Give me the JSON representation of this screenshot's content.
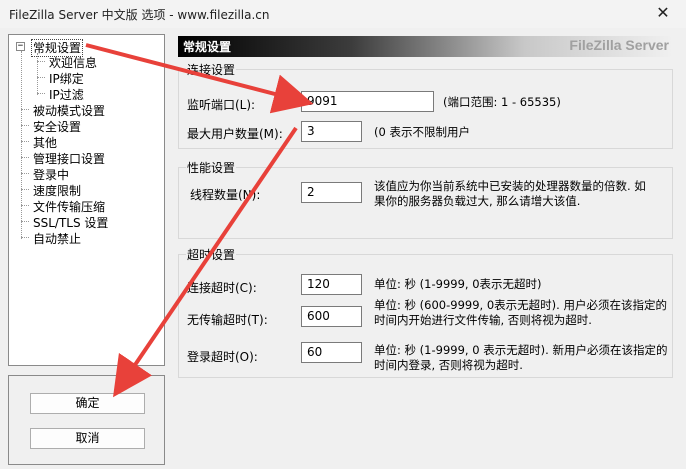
{
  "window": {
    "title": "FileZilla Server 中文版 选项 - www.filezilla.cn",
    "close_glyph": "✕"
  },
  "tree": {
    "items": [
      {
        "label": "常规设置",
        "expanded": true
      },
      {
        "label": "欢迎信息"
      },
      {
        "label": "IP绑定"
      },
      {
        "label": "IP过滤"
      },
      {
        "label": "被动模式设置"
      },
      {
        "label": "安全设置"
      },
      {
        "label": "其他"
      },
      {
        "label": "管理接口设置"
      },
      {
        "label": "登录中"
      },
      {
        "label": "速度限制"
      },
      {
        "label": "文件传输压缩"
      },
      {
        "label": "SSL/TLS 设置"
      },
      {
        "label": "自动禁止"
      }
    ],
    "expander_glyph": "−"
  },
  "buttons": {
    "ok": "确定",
    "cancel": "取消"
  },
  "header": {
    "title": "常规设置",
    "brand": "FileZilla Server"
  },
  "connection": {
    "legend": "连接设置",
    "port_label": "监听端口(L):",
    "port_value": "9091",
    "port_hint": "(端口范围: 1 - 65535)",
    "max_users_label": "最大用户数量(M):",
    "max_users_value": "3",
    "max_users_hint": "(0 表示不限制用户"
  },
  "performance": {
    "legend": "性能设置",
    "threads_label": "线程数量(N):",
    "threads_value": "2",
    "threads_hint_line1": "该值应为你当前系统中已安装的处理器数量的倍数. 如",
    "threads_hint_line2": "果你的服务器负载过大, 那么请增大该值."
  },
  "timeout": {
    "legend": "超时设置",
    "connect_label": "连接超时(C):",
    "connect_value": "120",
    "connect_hint": "单位: 秒 (1-9999, 0表示无超时)",
    "transfer_label": "无传输超时(T):",
    "transfer_value": "600",
    "transfer_hint_line1": "单位: 秒 (600-9999, 0表示无超时). 用户必须在该指定的",
    "transfer_hint_line2": "时间内开始进行文件传输, 否则将视为超时.",
    "login_label": "登录超时(O):",
    "login_value": "60",
    "login_hint_line1": "单位: 秒 (1-9999, 0 表示无超时). 新用户必须在该指定的",
    "login_hint_line2": "时间内登录, 否则将视为超时."
  },
  "annotation": {
    "arrow_color": "#e8413a"
  }
}
